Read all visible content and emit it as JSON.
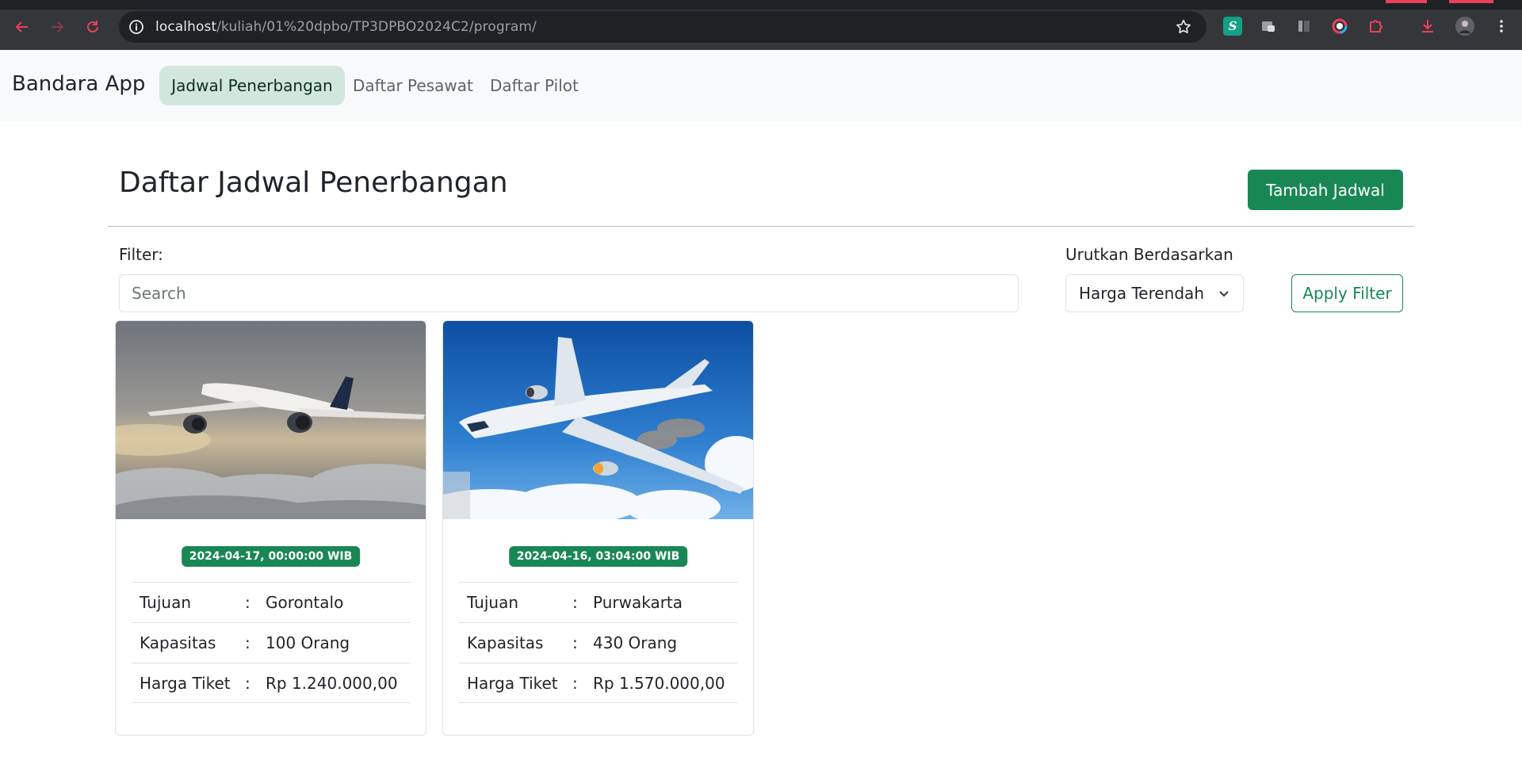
{
  "browser": {
    "url_host": "localhost",
    "url_path": "/kuliah/01%20dpbo/TP3DPBO2024C2/program/"
  },
  "navbar": {
    "brand": "Bandara App",
    "links": [
      {
        "label": "Jadwal Penerbangan",
        "active": true
      },
      {
        "label": "Daftar Pesawat",
        "active": false
      },
      {
        "label": "Daftar Pilot",
        "active": false
      }
    ]
  },
  "header": {
    "title": "Daftar Jadwal Penerbangan",
    "add_button": "Tambah Jadwal"
  },
  "filter": {
    "label": "Filter:",
    "search_placeholder": "Search",
    "sort_label": "Urutkan Berdasarkan",
    "sort_selected": "Harga Terendah",
    "apply_button": "Apply Filter"
  },
  "cards": [
    {
      "image": "airplane-above-clouds",
      "badge": "2024-04-17, 00:00:00 WIB",
      "rows": [
        {
          "key": "Tujuan",
          "sep": ":",
          "value": "Gorontalo"
        },
        {
          "key": "Kapasitas",
          "sep": ":",
          "value": "100 Orang"
        },
        {
          "key": "Harga Tiket",
          "sep": ":",
          "value": "Rp 1.240.000,00"
        }
      ]
    },
    {
      "image": "airplane-engine-smoke-blue-sky",
      "badge": "2024-04-16, 03:04:00 WIB",
      "rows": [
        {
          "key": "Tujuan",
          "sep": ":",
          "value": "Purwakarta"
        },
        {
          "key": "Kapasitas",
          "sep": ":",
          "value": "430 Orang"
        },
        {
          "key": "Harga Tiket",
          "sep": ":",
          "value": "Rp 1.570.000,00"
        }
      ]
    }
  ],
  "colors": {
    "primary_green": "#198754",
    "active_nav_bg": "#d1e7dd",
    "chrome_bg": "#35363a"
  }
}
